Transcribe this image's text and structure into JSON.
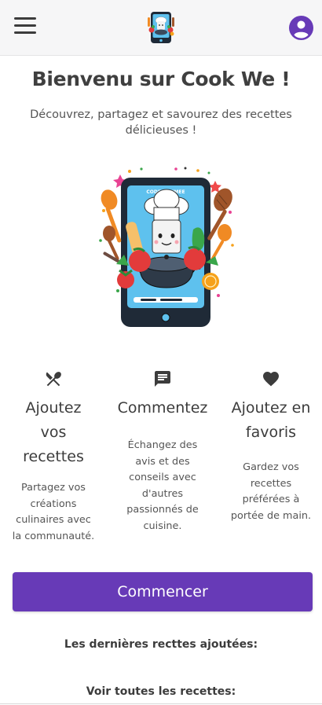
{
  "header": {
    "menu_icon": "hamburger-icon",
    "logo_icon": "chef-phone-logo",
    "account_icon": "account-circle-icon",
    "accent_color": "#673ab7"
  },
  "hero": {
    "title": "Bienvenu sur Cook We !",
    "subtitle": "Découvrez, partagez et savourez des recettes délicieuses !",
    "illustration": "chef-phone-illustration",
    "illustration_text": "CODETONIMEE"
  },
  "features": [
    {
      "icon": "utensils-icon",
      "title_lines": [
        "Ajoutez",
        "vos",
        "recettes"
      ],
      "text_lines": [
        "Partagez vos",
        "créations",
        "culinaires avec",
        "la communauté."
      ]
    },
    {
      "icon": "comment-icon",
      "title_lines": [
        "Commentez"
      ],
      "text_lines": [
        "Échangez des",
        "avis et des",
        "conseils avec",
        "d'autres",
        "passionnés de",
        "cuisine."
      ]
    },
    {
      "icon": "heart-icon",
      "title_lines": [
        "Ajoutez en",
        "favoris"
      ],
      "text_lines": [
        "Gardez vos",
        "recettes",
        "préférées à",
        "portée de main."
      ]
    }
  ],
  "cta": {
    "label": "Commencer",
    "color": "#673ab7"
  },
  "latest": {
    "title": "Les dernières recttes ajoutées:"
  },
  "see_all": {
    "label": "Voir toutes les recettes:"
  }
}
